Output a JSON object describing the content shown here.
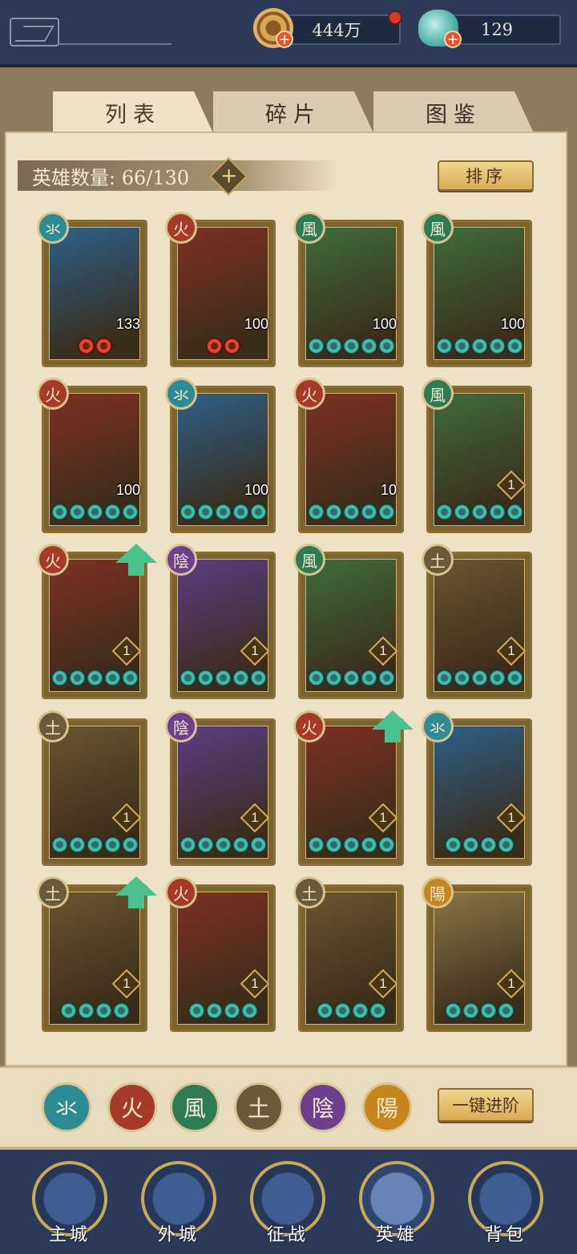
{
  "resources": {
    "coins": "444万",
    "gems": "129"
  },
  "tabs": [
    "列表",
    "碎片",
    "图鉴"
  ],
  "hero_count": "英雄数量: 66/130",
  "sort_label": "排序",
  "advance_label": "一键进阶",
  "element_filters": [
    "氺",
    "火",
    "風",
    "土",
    "陰",
    "陽"
  ],
  "colors": {
    "water": "#2f8b93",
    "fire": "#a53a2a",
    "wind": "#2e7a52",
    "earth": "#6b5a3a",
    "yin": "#6f3f8e",
    "yang": "#c7851e",
    "water_art": "#2d5f88",
    "fire_art": "#7d3022",
    "wind_art": "#3f6b3c",
    "earth_art": "#6b5330",
    "yin_art": "#5b3d83",
    "yang_art": "#8b7547"
  },
  "heroes": [
    {
      "element": "氺",
      "level": "133",
      "stars": 2,
      "star_color": "red"
    },
    {
      "element": "火",
      "level": "100",
      "stars": 2,
      "star_color": "red"
    },
    {
      "element": "風",
      "level": "100",
      "stars": 5,
      "star_color": "green"
    },
    {
      "element": "風",
      "level": "100",
      "stars": 5,
      "star_color": "green"
    },
    {
      "element": "火",
      "level": "100",
      "stars": 5,
      "star_color": "green"
    },
    {
      "element": "氺",
      "level": "100",
      "stars": 5,
      "star_color": "green"
    },
    {
      "element": "火",
      "level": "10",
      "stars": 5,
      "star_color": "green"
    },
    {
      "element": "風",
      "level": "1",
      "stars": 5,
      "star_color": "green"
    },
    {
      "element": "火",
      "level": "1",
      "stars": 5,
      "star_color": "green",
      "upgrade": true
    },
    {
      "element": "陰",
      "level": "1",
      "stars": 5,
      "star_color": "green"
    },
    {
      "element": "風",
      "level": "1",
      "stars": 5,
      "star_color": "green"
    },
    {
      "element": "土",
      "level": "1",
      "stars": 5,
      "star_color": "green"
    },
    {
      "element": "土",
      "level": "1",
      "stars": 5,
      "star_color": "green"
    },
    {
      "element": "陰",
      "level": "1",
      "stars": 5,
      "star_color": "green"
    },
    {
      "element": "火",
      "level": "1",
      "stars": 5,
      "star_color": "green",
      "upgrade": true
    },
    {
      "element": "氺",
      "level": "1",
      "stars": 4,
      "star_color": "green"
    },
    {
      "element": "土",
      "level": "1",
      "stars": 4,
      "star_color": "green",
      "upgrade": true
    },
    {
      "element": "火",
      "level": "1",
      "stars": 4,
      "star_color": "green"
    },
    {
      "element": "土",
      "level": "1",
      "stars": 4,
      "star_color": "green"
    },
    {
      "element": "陽",
      "level": "1",
      "stars": 4,
      "star_color": "green"
    }
  ],
  "nav": [
    "主城",
    "外城",
    "征战",
    "英雄",
    "背包"
  ],
  "nav_active": "英雄"
}
